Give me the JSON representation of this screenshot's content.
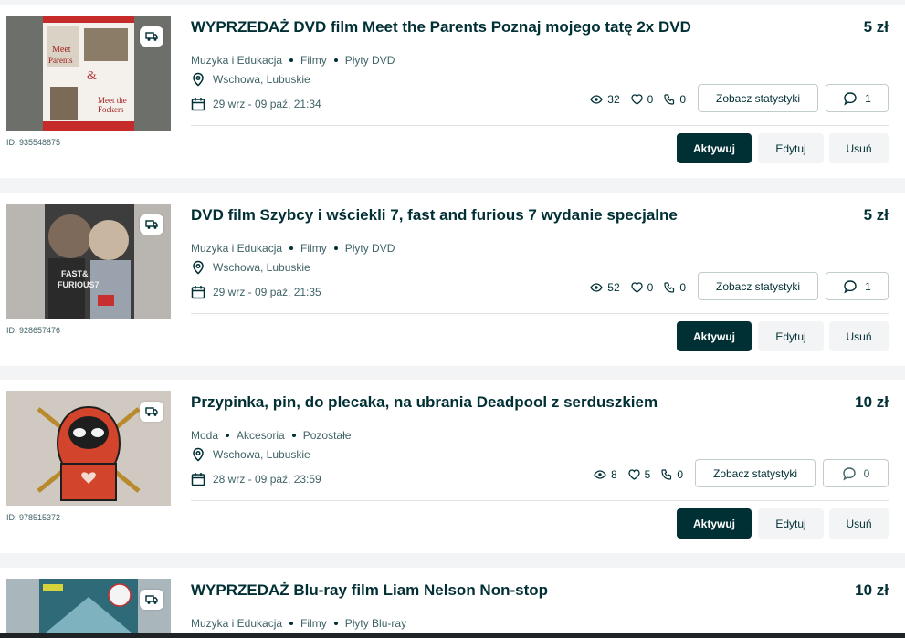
{
  "listings": [
    {
      "title": "WYPRZEDAŻ DVD film Meet the Parents Poznaj mojego tatę 2x DVD",
      "price": "5 zł",
      "categories": [
        "Muzyka i Edukacja",
        "Filmy",
        "Płyty DVD"
      ],
      "location": "Wschowa, Lubuskie",
      "dates": "29 wrz - 09 paź, 21:34",
      "id_label": "ID: 935548875",
      "views": "32",
      "likes": "0",
      "calls": "0",
      "messages": "1",
      "image": "meet-the-parents-dvd-photo"
    },
    {
      "title": "DVD film Szybcy i wściekli 7, fast and furious 7 wydanie specjalne",
      "price": "5 zł",
      "categories": [
        "Muzyka i Edukacja",
        "Filmy",
        "Płyty DVD"
      ],
      "location": "Wschowa, Lubuskie",
      "dates": "29 wrz - 09 paź, 21:35",
      "id_label": "ID: 928657476",
      "views": "52",
      "likes": "0",
      "calls": "0",
      "messages": "1",
      "image": "fast-furious-7-dvd-photo"
    },
    {
      "title": "Przypinka, pin, do plecaka, na ubrania Deadpool z serduszkiem",
      "price": "10 zł",
      "categories": [
        "Moda",
        "Akcesoria",
        "Pozostałe"
      ],
      "location": "Wschowa, Lubuskie",
      "dates": "28 wrz - 09 paź, 23:59",
      "id_label": "ID: 978515372",
      "views": "8",
      "likes": "5",
      "calls": "0",
      "messages": "0",
      "image": "deadpool-pin-photo"
    },
    {
      "title": "WYPRZEDAŻ Blu-ray film Liam Nelson Non-stop",
      "price": "10 zł",
      "categories": [
        "Muzyka i Edukacja",
        "Filmy",
        "Płyty Blu-ray"
      ],
      "image": "non-stop-bluray-photo"
    }
  ],
  "actions": {
    "stats_label": "Zobacz statystyki",
    "activate_label": "Aktywuj",
    "edit_label": "Edytuj",
    "delete_label": "Usuń"
  },
  "icons": {
    "delivery": "truck-icon",
    "location": "pin-icon",
    "date": "calendar-icon",
    "views": "eye-icon",
    "likes": "heart-icon",
    "calls": "phone-icon",
    "messages": "chat-bubble-icon"
  },
  "colors": {
    "primary": "#002f34",
    "secondary_text": "#406367",
    "border": "#c3cccd",
    "background": "#f2f4f5"
  }
}
